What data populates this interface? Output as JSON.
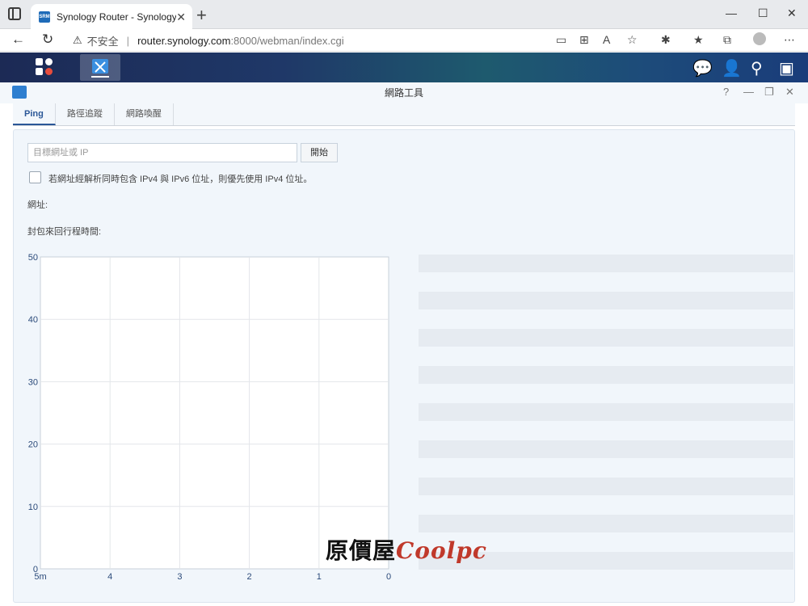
{
  "browser": {
    "tab_title": "Synology Router - SynologyRout",
    "tab_favicon": "SRM",
    "url_warning": "不安全",
    "url_host": "router.synology.com",
    "url_path": ":8000/webman/index.cgi"
  },
  "window": {
    "title": "網路工具",
    "tabs": [
      {
        "label": "Ping"
      },
      {
        "label": "路徑追蹤"
      },
      {
        "label": "網路喚醒"
      }
    ]
  },
  "ping": {
    "target_placeholder": "目標網址或 IP",
    "start_label": "開始",
    "checkbox_label": "若網址經解析同時包含 IPv4 與 IPv6 位址，則優先使用 IPv4 位址。",
    "address_label": "網址:",
    "rtt_label": "封包來回行程時間:"
  },
  "chart_data": {
    "type": "line",
    "x_ticks": [
      "5m",
      "4",
      "3",
      "2",
      "1",
      "0"
    ],
    "y_ticks": [
      0,
      10,
      20,
      30,
      40,
      50
    ],
    "ylim": [
      0,
      50
    ],
    "series": [],
    "grid": true
  },
  "watermark": {
    "text_cn": "原價屋",
    "text_logo": "Coolpc"
  }
}
